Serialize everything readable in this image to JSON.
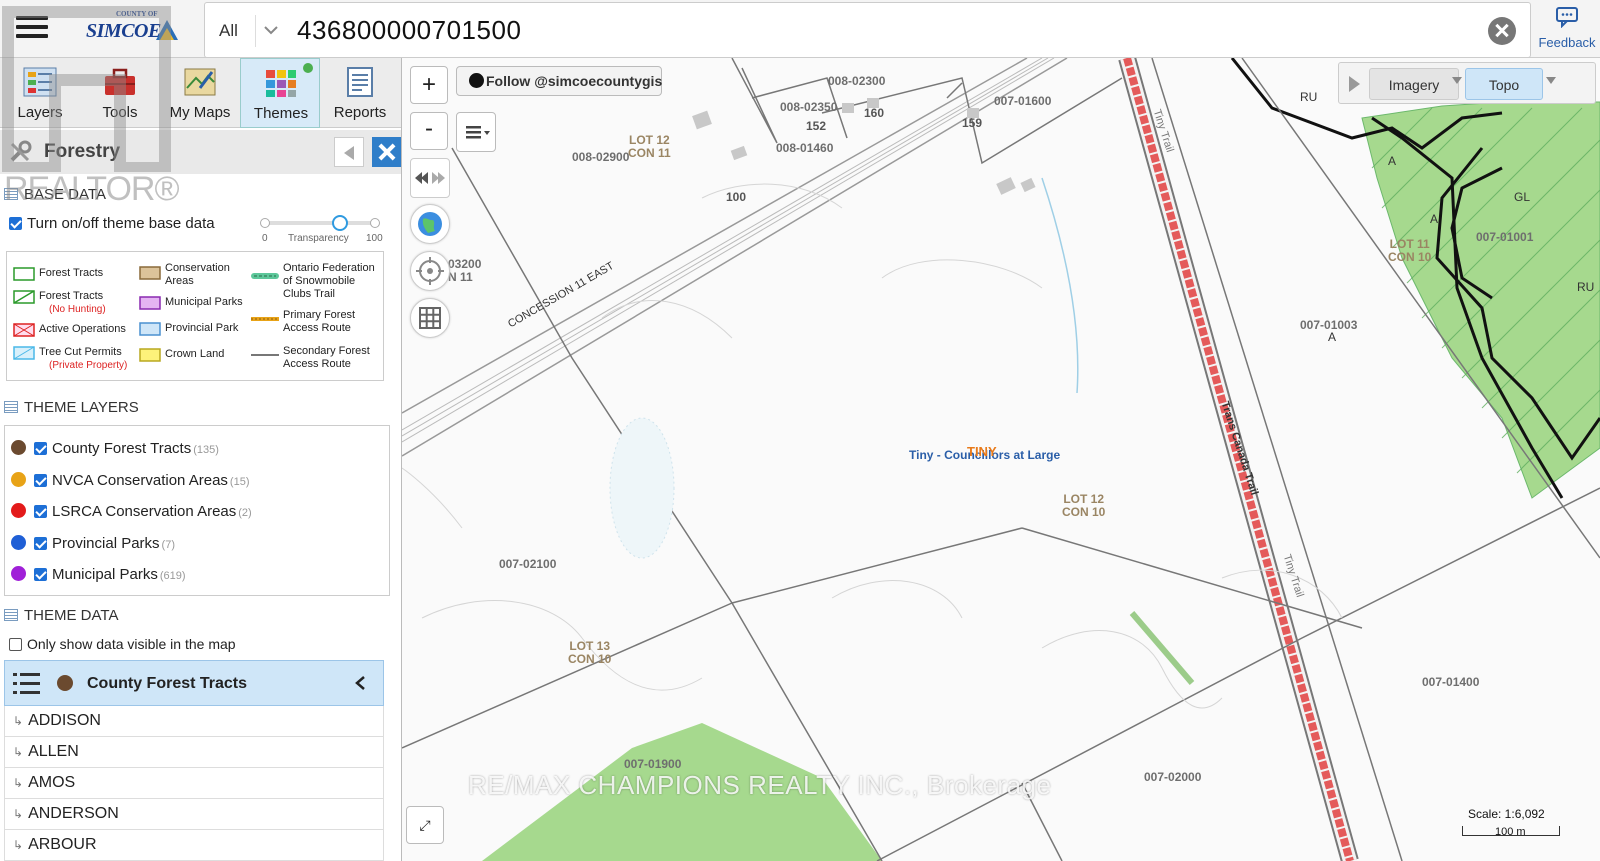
{
  "header": {
    "logo_small": "COUNTY OF",
    "logo_big": "SIMCOE",
    "search_scope": "All",
    "search_value": "436800000701500",
    "feedback_label": "Feedback"
  },
  "toolbar": {
    "tools": [
      {
        "label": "Layers",
        "icon": "layers-icon"
      },
      {
        "label": "Tools",
        "icon": "toolbox-icon"
      },
      {
        "label": "My Maps",
        "icon": "my-maps-icon"
      },
      {
        "label": "Themes",
        "icon": "themes-icon",
        "active": true
      },
      {
        "label": "Reports",
        "icon": "reports-icon"
      }
    ]
  },
  "panel": {
    "title": "Forestry",
    "base_data_heading": "BASE DATA",
    "base_toggle_label": "Turn on/off theme base data",
    "transparency": {
      "min_label": "0",
      "label": "Transparency",
      "max_label": "100",
      "value": 70
    },
    "legend": [
      {
        "label": "Forest Tracts",
        "sub": ""
      },
      {
        "label": "Forest Tracts",
        "sub": "(No Hunting)"
      },
      {
        "label": "Active Operations",
        "sub": ""
      },
      {
        "label": "Tree Cut Permits",
        "sub": "(Private Property)"
      },
      {
        "label": "Conservation",
        "label2": "Areas"
      },
      {
        "label": "Municipal Parks"
      },
      {
        "label": "Provincial Park"
      },
      {
        "label": "Crown Land"
      },
      {
        "label": "Ontario Federation",
        "label2": "of Snowmobile",
        "label3": "Clubs Trail"
      },
      {
        "label": "Primary Forest",
        "label2": "Access Route"
      },
      {
        "label": "Secondary Forest",
        "label2": "Access Route"
      }
    ],
    "theme_layers_heading": "THEME LAYERS",
    "theme_layers": [
      {
        "name": "County Forest Tracts",
        "count": "(135)",
        "color": "#6b4a2f"
      },
      {
        "name": "NVCA Conservation Areas",
        "count": "(15)",
        "color": "#e8a317"
      },
      {
        "name": "LSRCA Conservation Areas",
        "count": "(2)",
        "color": "#e31b1b"
      },
      {
        "name": "Provincial Parks",
        "count": "(7)",
        "color": "#1f5fd6"
      },
      {
        "name": "Municipal Parks",
        "count": "(619)",
        "color": "#a020d8"
      }
    ],
    "theme_data_heading": "THEME DATA",
    "only_show_label": "Only show data visible in the map",
    "tract_group": "County Forest Tracts",
    "tract_items": [
      "ADDISON",
      "ALLEN",
      "AMOS",
      "ANDERSON",
      "ARBOUR"
    ]
  },
  "map": {
    "follow_label": "Follow @simcoecountygis",
    "zoom_in": "+",
    "zoom_out": "-",
    "basemap_imagery": "Imagery",
    "basemap_topo": "Topo",
    "scale_text": "Scale: 1:6,092",
    "scale_bar_label": "100 m",
    "labels": {
      "p_008_02300": "008-02300",
      "p_008_02350": "008-02350",
      "p_008_0146": "008-01460",
      "p_007_01600": "007-01600",
      "p_008_02900": "008-02900",
      "lot12con11_a": "LOT 12",
      "lot12con11_b": "CON 11",
      "a_152": "152",
      "a_160": "160",
      "a_159": "159",
      "a_100": "100",
      "p_03200": "03200",
      "n_11": "N 11",
      "road": "CONCESSION 11 EAST",
      "trail_tiny1": "Tiny Trail",
      "trail_tcn": "Trans Canada Trail",
      "trail_tiny2": "Tiny Trail",
      "ru1": "RU",
      "ru2": "RU",
      "a1": "A",
      "a2": "A",
      "gl": "GL",
      "lot11con10_a": "LOT 11",
      "lot11con10_b": "CON 10",
      "p_007_01001": "007-01001",
      "p_007_01003": "007-01003",
      "a3": "A",
      "tiny_center": "Tiny - Councillors at Large",
      "tiny_orange": "TINY",
      "lot12con10_a": "LOT 12",
      "lot12con10_b": "CON 10",
      "p_007_02100": "007-02100",
      "lot13con10_a": "LOT 13",
      "lot13con10_b": "CON 10",
      "p_007_01400": "007-01400",
      "p_007_01900": "007-01900",
      "p_007_02000": "007-02000"
    }
  },
  "watermarks": {
    "brokerage": "RE/MAX CHAMPIONS REALTY INC., Brokerage",
    "realtor": "REALTOR®"
  },
  "colors": {
    "accent_blue": "#2f7ec9",
    "active_tab": "#d7eaf8",
    "forest_green": "#9bd08a",
    "trail_red": "#e45a5a"
  }
}
